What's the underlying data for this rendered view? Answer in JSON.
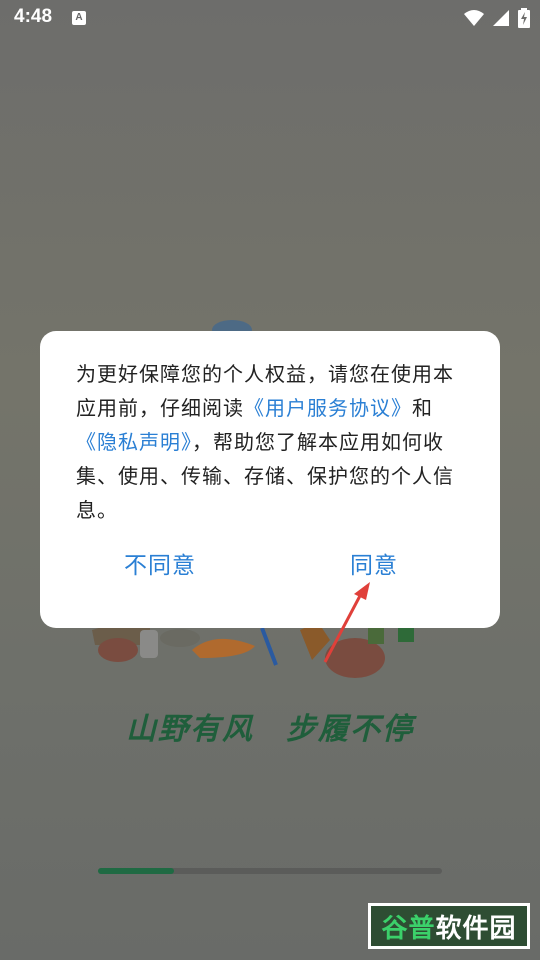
{
  "status_bar": {
    "time": "4:48",
    "notification_icon": "A"
  },
  "dialog": {
    "text_1": "为更好保障您的个人权益，请您在使用本应用前，仔细阅读",
    "link_terms": "《用户服务协议》",
    "text_2": "和",
    "link_privacy": "《隐私声明》",
    "text_3": "，帮助您了解本应用如何收集、使用、传输、存储、保护您的个人信息。",
    "disagree_label": "不同意",
    "agree_label": "同意"
  },
  "slogan": "山野有风　步履不停",
  "progress": 0.22,
  "watermark": {
    "part_1": "谷普",
    "part_2": "软件园"
  },
  "colors": {
    "link": "#2a7fd4",
    "slogan": "#1f5e3b",
    "progress": "#1f6a43"
  }
}
